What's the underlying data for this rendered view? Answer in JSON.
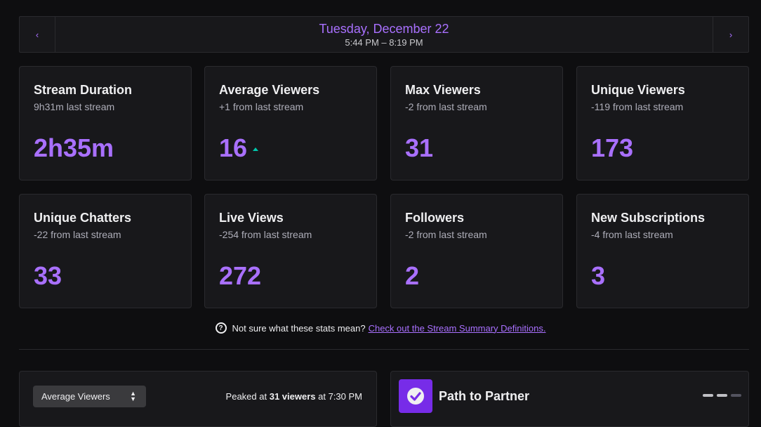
{
  "date_nav": {
    "prev_icon": "chevron-left-icon",
    "prev_glyph": "‹",
    "title": "Tuesday, December 22",
    "range": "5:44 PM – 8:19 PM",
    "next_icon": "chevron-right-icon",
    "next_glyph": "›"
  },
  "stats": [
    {
      "title": "Stream Duration",
      "sub": "9h31m last stream",
      "value": "2h35m"
    },
    {
      "title": "Average Viewers",
      "sub": "+1 from last stream",
      "value": "16",
      "trend": "up"
    },
    {
      "title": "Max Viewers",
      "sub": "-2 from last stream",
      "value": "31"
    },
    {
      "title": "Unique Viewers",
      "sub": "-119 from last stream",
      "value": "173"
    },
    {
      "title": "Unique Chatters",
      "sub": "-22 from last stream",
      "value": "33"
    },
    {
      "title": "Live Views",
      "sub": "-254 from last stream",
      "value": "272"
    },
    {
      "title": "Followers",
      "sub": "-2 from last stream",
      "value": "2"
    },
    {
      "title": "New Subscriptions",
      "sub": "-4 from last stream",
      "value": "3"
    }
  ],
  "help": {
    "icon": "question-circle-icon",
    "glyph": "?",
    "text": "Not sure what these stats mean?",
    "link": "Check out the Stream Summary Definitions."
  },
  "chart_panel": {
    "select_value": "Average Viewers",
    "peak_prefix": "Peaked at",
    "peak_value": "31 viewers",
    "peak_suffix": "at 7:30 PM"
  },
  "partner_panel": {
    "title": "Path to Partner",
    "badge_icon": "checkmark-icon",
    "pager": {
      "count": 3,
      "active": [
        0,
        1
      ]
    }
  },
  "colors": {
    "accent": "#a970ff",
    "background": "#0e0e10",
    "card": "#18181b",
    "trend_up": "#00c7ac",
    "badge": "#772ce8"
  }
}
